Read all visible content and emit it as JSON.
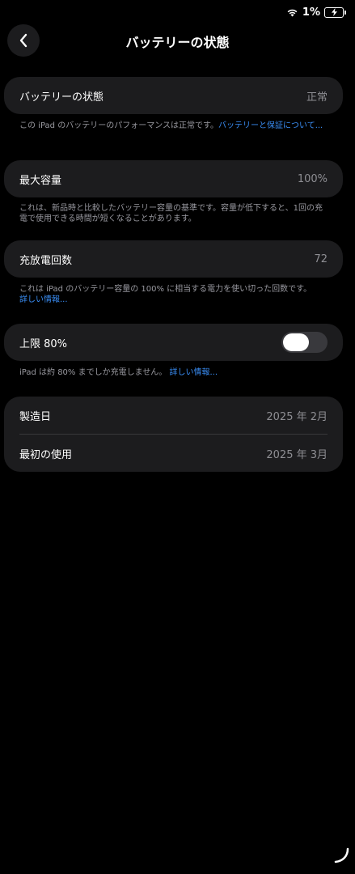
{
  "status_bar": {
    "battery_percent": "1%",
    "wifi_icon": "wifi-icon",
    "battery_icon": "battery-charging-icon"
  },
  "nav": {
    "title": "バッテリーの状態",
    "back_icon": "chevron-left-icon"
  },
  "sections": {
    "health": {
      "label": "バッテリーの状態",
      "value": "正常",
      "footnote_text": "この iPad のバッテリーのパフォーマンスは正常です。",
      "footnote_link": "バッテリーと保証について..."
    },
    "capacity": {
      "label": "最大容量",
      "value": "100%",
      "footnote_text": "これは、新品時と比較したバッテリー容量の基準です。容量が低下すると、1回の充電で使用できる時間が短くなることがあります。"
    },
    "cycles": {
      "label": "充放電回数",
      "value": "72",
      "footnote_text": "これは iPad のバッテリー容量の 100% に相当する電力を使い切った回数です。",
      "footnote_link": "詳しい情報..."
    },
    "limit": {
      "label": "上限 80%",
      "toggle_on": false,
      "footnote_text": "iPad は約 80% までしか充電しません。",
      "footnote_link": "詳しい情報..."
    },
    "dates": {
      "manufactured_label": "製造日",
      "manufactured_value": "2025 年 2月",
      "first_use_label": "最初の使用",
      "first_use_value": "2025 年 3月"
    }
  },
  "colors": {
    "background": "#000000",
    "card": "#1c1c1e",
    "link": "#3a8ef6",
    "secondary_text": "#8e8e93"
  }
}
